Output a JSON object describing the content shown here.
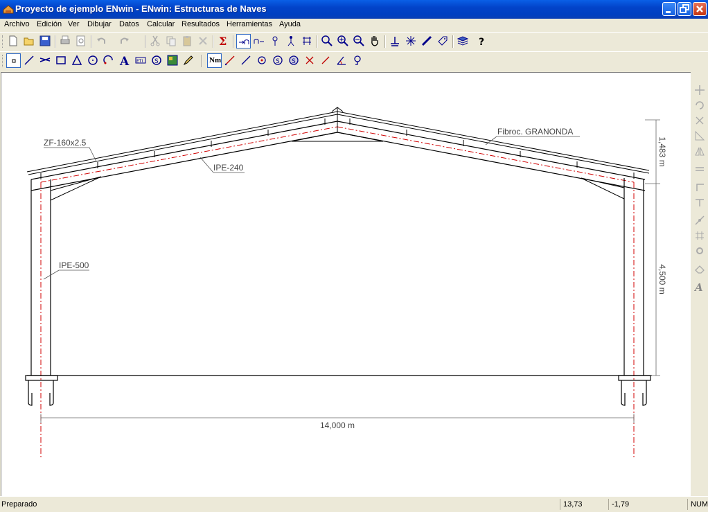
{
  "window": {
    "title": "Proyecto de ejemplo ENwin - ENwin: Estructuras de Naves"
  },
  "menu": [
    "Archivo",
    "Edición",
    "Ver",
    "Dibujar",
    "Datos",
    "Calcular",
    "Resultados",
    "Herramientas",
    "Ayuda"
  ],
  "toolbar2": {
    "nm_label": "Nm"
  },
  "drawing": {
    "labels": {
      "purlin": "ZF-160x2.5",
      "rafter": "IPE-240",
      "cladding": "Fibroc. GRANONDA",
      "column": "IPE-500"
    },
    "dimensions": {
      "roof_rise": "1,483 m",
      "column_height": "4,500 m",
      "span": "14,000 m"
    }
  },
  "status": {
    "message": "Preparado",
    "x_coord": "13,73",
    "y_coord": "-1,79",
    "num": "NUM"
  },
  "colors": {
    "titlebar": "#0243c9",
    "axis": "#d00000"
  }
}
